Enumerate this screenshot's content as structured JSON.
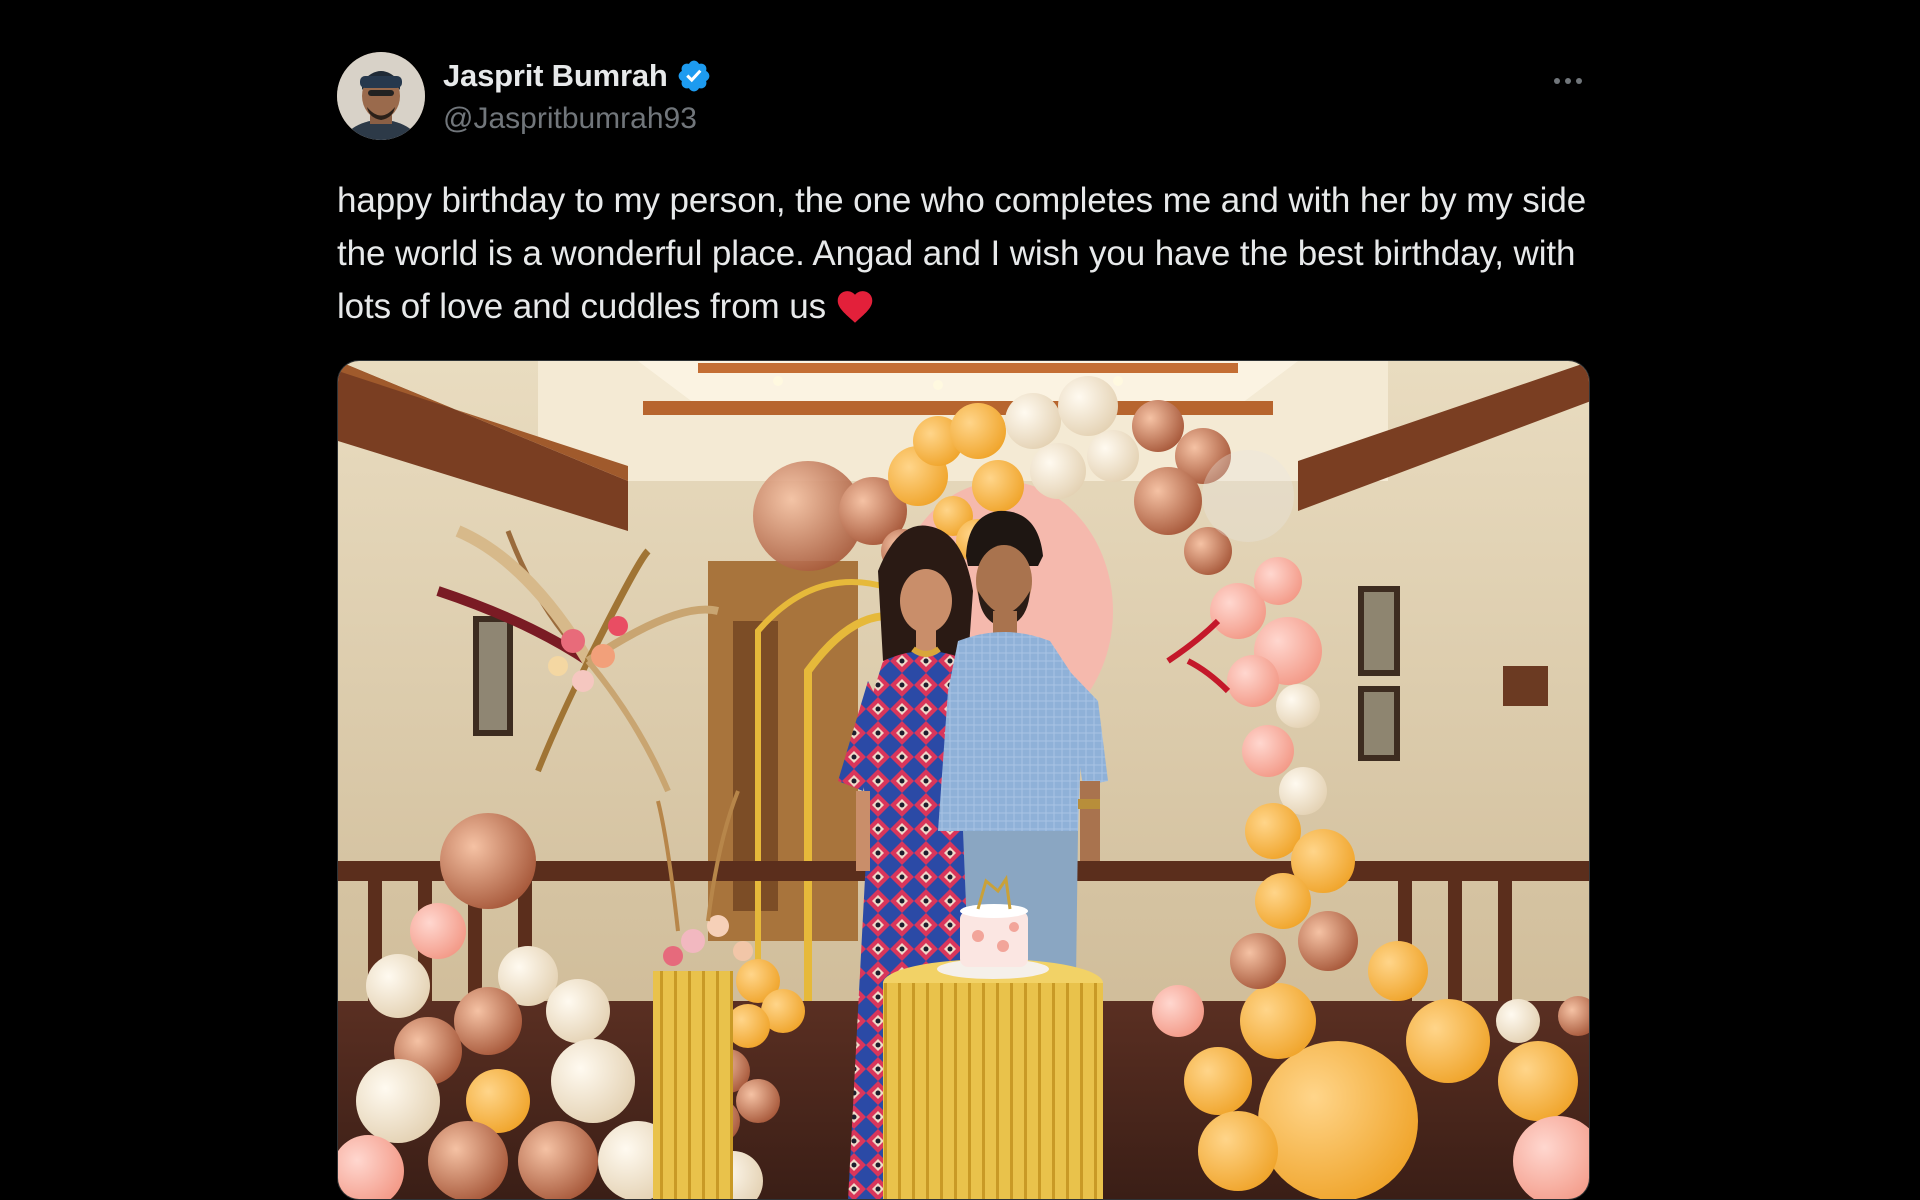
{
  "tweet": {
    "author": {
      "display_name": "Jasprit Bumrah",
      "handle": "@Jaspritbumrah93",
      "verified": true,
      "verified_color": "#1d9bf0"
    },
    "text": "happy birthday to my person, the one who completes me and with her by my side the world is a wonderful place. Angad and I wish you have the best birthday, with lots of love and cuddles from us",
    "emoji": "red-heart-icon",
    "media": {
      "type": "photo",
      "alt_icon": "birthday-photo-image"
    }
  },
  "colors": {
    "background": "#000000",
    "text_primary": "#e7e9ea",
    "text_secondary": "#71767b",
    "heart": "#e3203a"
  }
}
